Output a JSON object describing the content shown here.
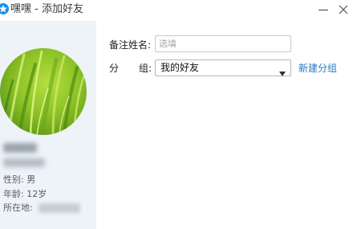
{
  "window": {
    "title": "嘿嘿 - 添加好友",
    "logo_icon": "app-logo-icon",
    "minimize_icon": "minimize-icon",
    "close_icon": "close-icon"
  },
  "profile": {
    "avatar_icon": "grass-avatar-image",
    "gender": "性别: 男",
    "age": "年龄: 12岁",
    "location_label": "所在地:"
  },
  "form": {
    "remark_label": "备注姓名:",
    "remark_placeholder": "选填",
    "remark_value": "",
    "group_label_first": "分",
    "group_label_second": "组:",
    "group_selected": "我的好友",
    "dropdown_icon": "chevron-down-icon",
    "new_group_link": "新建分组"
  },
  "colors": {
    "accent": "#1e8ef0",
    "link": "#2b77c0",
    "panel_bg": "#eef3f8"
  }
}
